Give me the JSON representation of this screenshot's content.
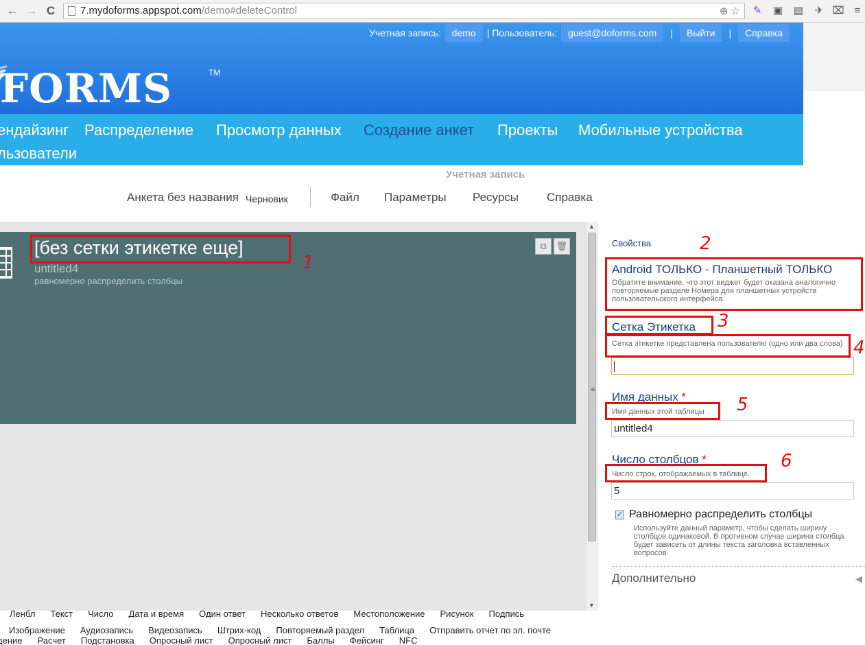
{
  "browser": {
    "url_host": "7.mydoforms.appspot.com",
    "url_path": "/demo#deleteControl",
    "back": "←",
    "forward": "→",
    "reload": "C"
  },
  "header": {
    "account_label": "Учетная запись:",
    "account_value": "demo",
    "user_label": "| Пользователь:",
    "user_value": "guest@doforms.com",
    "sep1": "|",
    "logout": "Выйти",
    "sep2": "|",
    "help": "Справка",
    "logo": "FORMS",
    "logo_tm": "TM"
  },
  "mainnav": {
    "items": [
      "ендайзинг",
      "Распределение",
      "Просмотр данных",
      "Создание анкет",
      "Проекты",
      "Мобильные устройства",
      "льзователи"
    ]
  },
  "subheader": {
    "account": "Учетная запись",
    "form_name": "Анкета без названия",
    "status": "Черновик",
    "menu": [
      "Файл",
      "Параметры",
      "Ресурсы",
      "Справка"
    ]
  },
  "widget": {
    "title": "[без сетки этикетке еще]",
    "name": "untitled4",
    "subtitle": "равномерно распределить столбцы"
  },
  "properties": {
    "heading": "Свойства",
    "android": "Android ТОЛЬКО - Планшетный ТОЛЬКО",
    "android_note": "Обратите внимание, что этот виджет будет оказана аналогично повторяемые разделе Номера для планшетных устройств пользовательского интерфейса.",
    "grid_label": "Сетка Этикетка",
    "grid_note": "Сетка этикетке представлена пользователю (одно или два слова)",
    "grid_value": "",
    "dataname_label": "Имя данных",
    "dataname_note": "Имя данных этой таблицы",
    "dataname_value": "untitled4",
    "columns_label": "Число столбцов",
    "columns_note": "Число строк, отображаемых в таблице.",
    "columns_value": "5",
    "even_label": "Равномерно распределить столбцы",
    "even_note": "Используйте данный параметр, чтобы сделать ширину столбцов одинаковой. В противном случае ширина столбца будет зависеть от длины текста заголовка вставленных вопросов.",
    "even_checked": true,
    "more": "Дополнительно",
    "required_mark": "*"
  },
  "annotations": [
    "1",
    "2",
    "3",
    "4",
    "5",
    "6"
  ],
  "toolbar": {
    "row1": [
      "Ленбл",
      "Текст",
      "Число",
      "Дата и время",
      "Один ответ",
      "Несколько ответов",
      "Местоположение",
      "Рисунок",
      "Подпись"
    ],
    "row2": [
      "Изображение",
      "Аудиозапись",
      "Видеозапись",
      "Штрих-код",
      "Повторяемый раздел",
      "Таблица",
      "Отправить отчет по эл. почте"
    ],
    "row3": [
      "дение",
      "Расчет",
      "Подстановка",
      "Опросный лист",
      "Опросный лист",
      "Баллы",
      "Фейсинг",
      "NFC"
    ]
  },
  "colors": {
    "header_blue": "#2a83e4",
    "nav_blue": "#29aee9",
    "widget_bg": "#506f73",
    "annotation_red": "#e01010"
  }
}
